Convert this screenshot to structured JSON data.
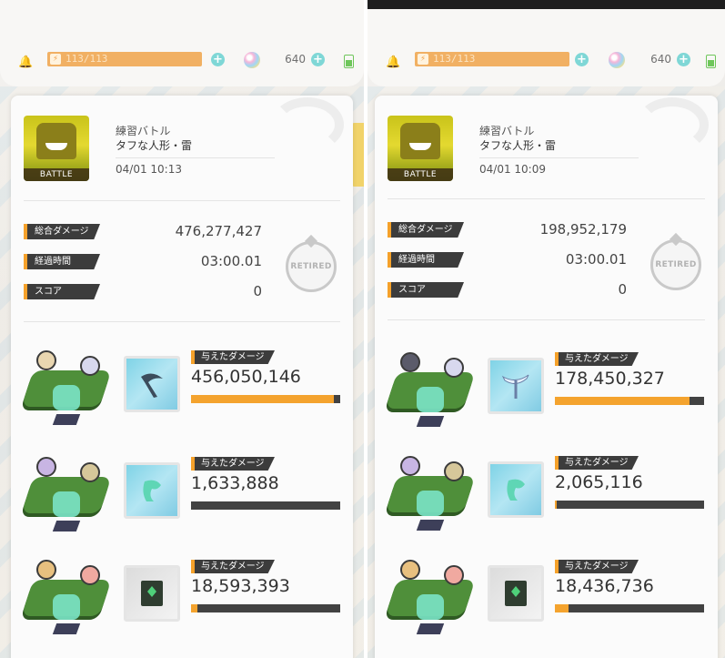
{
  "common": {
    "stamina_text": "113/113",
    "currency_value": "640",
    "battle_label": "BATTLE",
    "quest_type": "練習バトル",
    "quest_target": "タフな人形・雷",
    "stat_labels": [
      "総合ダメージ",
      "経過時間",
      "スコア"
    ],
    "damage_label": "与えたダメージ",
    "retired_label": "RETIRED"
  },
  "screens": [
    {
      "date": "04/01 10:13",
      "total_damage": "476,277,427",
      "elapsed": "03:00.01",
      "score": "0",
      "members": [
        {
          "damage": "456,050,146",
          "share": 0.96,
          "item": "scythe-icon"
        },
        {
          "damage": "1,633,888",
          "share": 0.0,
          "item": "glove-icon"
        },
        {
          "damage": "18,593,393",
          "share": 0.04,
          "item": "book-icon"
        }
      ]
    },
    {
      "date": "04/01 10:09",
      "total_damage": "198,952,179",
      "elapsed": "03:00.01",
      "score": "0",
      "members": [
        {
          "damage": "178,450,327",
          "share": 0.9,
          "item": "crossbow-icon"
        },
        {
          "damage": "2,065,116",
          "share": 0.01,
          "item": "glove-icon"
        },
        {
          "damage": "18,436,736",
          "share": 0.09,
          "item": "book-icon"
        }
      ]
    }
  ],
  "colors": {
    "accent": "#f5a12a",
    "bar_bg": "#424242",
    "label_bg": "#3c3c3c"
  }
}
